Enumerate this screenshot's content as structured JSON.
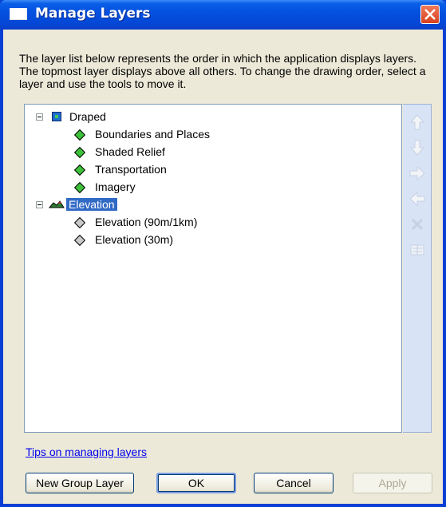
{
  "window": {
    "title": "Manage Layers",
    "description": "The layer list below represents the order in which the application displays layers. The topmost layer displays above all others. To change the drawing order, select a layer and use the tools to move it."
  },
  "tree": {
    "groups": [
      {
        "label": "Draped",
        "expanded": true,
        "icon": "draped-layer-icon",
        "children": [
          {
            "label": "Boundaries and Places",
            "icon": "green-diamond"
          },
          {
            "label": "Shaded Relief",
            "icon": "green-diamond"
          },
          {
            "label": "Transportation",
            "icon": "green-diamond"
          },
          {
            "label": "Imagery",
            "icon": "green-diamond"
          }
        ]
      },
      {
        "label": "Elevation",
        "expanded": true,
        "selected": true,
        "icon": "elevation-layer-icon",
        "children": [
          {
            "label": "Elevation (90m/1km)",
            "icon": "grey-diamond"
          },
          {
            "label": "Elevation (30m)",
            "icon": "grey-diamond"
          }
        ]
      }
    ]
  },
  "tools": [
    "move-up-icon",
    "move-down-icon",
    "move-right-icon",
    "move-left-icon",
    "delete-icon",
    "properties-icon"
  ],
  "tips_link": "Tips on managing layers",
  "buttons": {
    "new_group": "New Group Layer",
    "ok": "OK",
    "cancel": "Cancel",
    "apply": "Apply"
  },
  "colors": {
    "selection": "#316ac5",
    "layer_active": "#3ec13a",
    "layer_inactive": "#c9c9c9",
    "title_bar": "#0451e0"
  }
}
